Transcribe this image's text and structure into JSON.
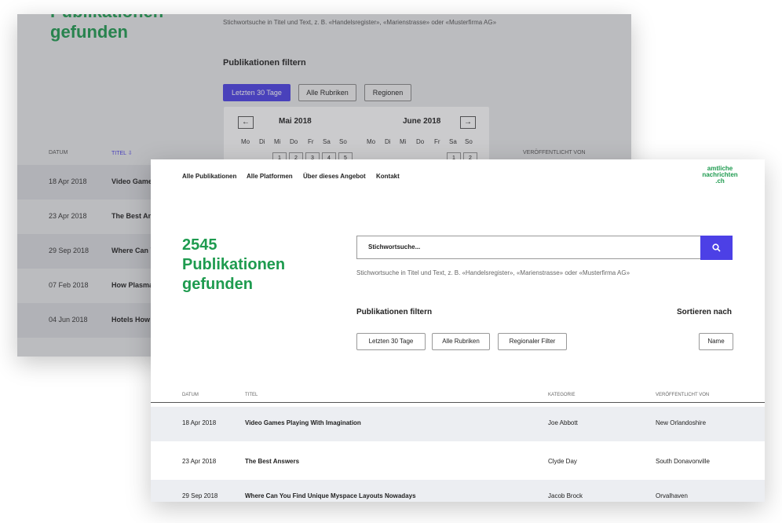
{
  "back": {
    "title_line1": "Publikationen",
    "title_line2": "gefunden",
    "hint": "Stichwortsuche in Titel und Text, z. B. «Handelsregister», «Marienstrasse» oder «Musterfirma AG»",
    "filter_heading": "Publikationen filtern",
    "buttons": [
      "Letzten 30 Tage",
      "Alle Rubriken",
      "Regionen"
    ],
    "calendar": {
      "prev_icon": "←",
      "next_icon": "→",
      "month_left": "Mai 2018",
      "month_right": "June 2018",
      "weekdays": [
        "Mo",
        "Di",
        "Mi",
        "Do",
        "Fr",
        "Sa",
        "So"
      ],
      "days_left": [
        "1",
        "2",
        "3",
        "4",
        "5"
      ],
      "days_right": [
        "1",
        "2"
      ]
    },
    "table_headers": {
      "date": "DATUM",
      "title": "TITEL ⇩",
      "published_by": "VERÖFFENTLICHT VON"
    },
    "rows": [
      {
        "date": "18 Apr 2018",
        "title": "Video Games"
      },
      {
        "date": "23 Apr 2018",
        "title": "The Best Ans"
      },
      {
        "date": "29 Sep 2018",
        "title": "Where Can Y"
      },
      {
        "date": "07 Feb 2018",
        "title": "How Plasma"
      },
      {
        "date": "04 Jun 2018",
        "title": "Hotels How T"
      }
    ]
  },
  "front": {
    "nav": [
      "Alle Publikationen",
      "Alle Platformen",
      "Über dieses Angebot",
      "Kontakt"
    ],
    "logo": [
      "amtliche",
      "nachrichten",
      ".ch"
    ],
    "count": "2545",
    "title_line1": "Publikationen",
    "title_line2": "gefunden",
    "search_value": "Stichwortsuche...",
    "search_icon": "search-icon",
    "hint": "Stichwortsuche in Titel und Text, z. B. «Handelsregister», «Marienstrasse» oder «Musterfirma AG»",
    "filter_heading": "Publikationen filtern",
    "sort_heading": "Sortieren nach",
    "filter_buttons": [
      "Letzten 30 Tage",
      "Alle Rubriken",
      "Regionaler Filter"
    ],
    "sort_button": "Name",
    "table_headers": [
      "DATUM",
      "TITEL",
      "KATEGORIE",
      "VERÖFFENTLICHT VON"
    ],
    "rows": [
      {
        "date": "18 Apr 2018",
        "title": "Video Games Playing With Imagination",
        "category": "Joe Abbott",
        "published_by": "New Orlandoshire"
      },
      {
        "date": "23 Apr 2018",
        "title": "The Best Answers",
        "category": "Clyde Day",
        "published_by": "South Donavonville"
      },
      {
        "date": "29 Sep 2018",
        "title": "Where Can You Find Unique Myspace Layouts Nowadays",
        "category": "Jacob Brock",
        "published_by": "Orvalhaven"
      }
    ]
  },
  "colors": {
    "accent": "#4c40e6",
    "brand_green": "#1e9b4f"
  }
}
